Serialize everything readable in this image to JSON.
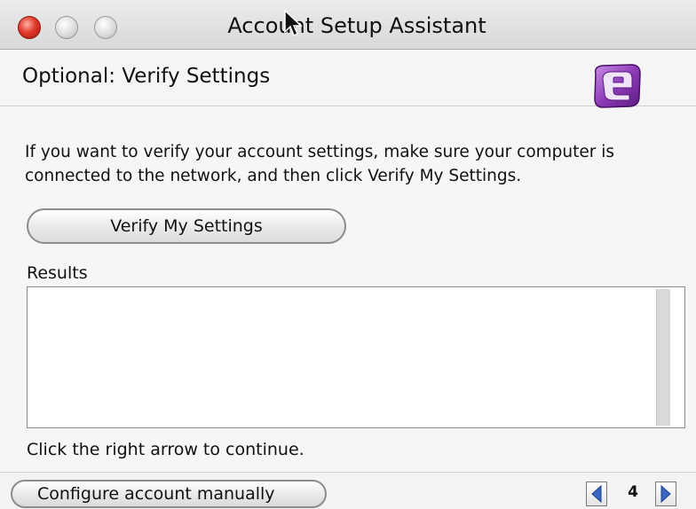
{
  "window": {
    "title": "Account Setup Assistant"
  },
  "header": {
    "title": "Optional: Verify Settings",
    "logo_icon": "entourage-logo-icon"
  },
  "body": {
    "instructions": "If you want to verify your account settings, make sure your computer is connected to the network, and then click Verify My Settings.",
    "verify_button_label": "Verify My Settings",
    "results_label": "Results",
    "results_text": "",
    "continue_hint": "Click the right arrow to continue."
  },
  "footer": {
    "configure_button_label": "Configure account manually",
    "page_number": "4",
    "prev_icon": "triangle-left-icon",
    "next_icon": "triangle-right-icon"
  },
  "colors": {
    "close_button": "#e2392a",
    "logo_purple": "#8e3bb8"
  }
}
